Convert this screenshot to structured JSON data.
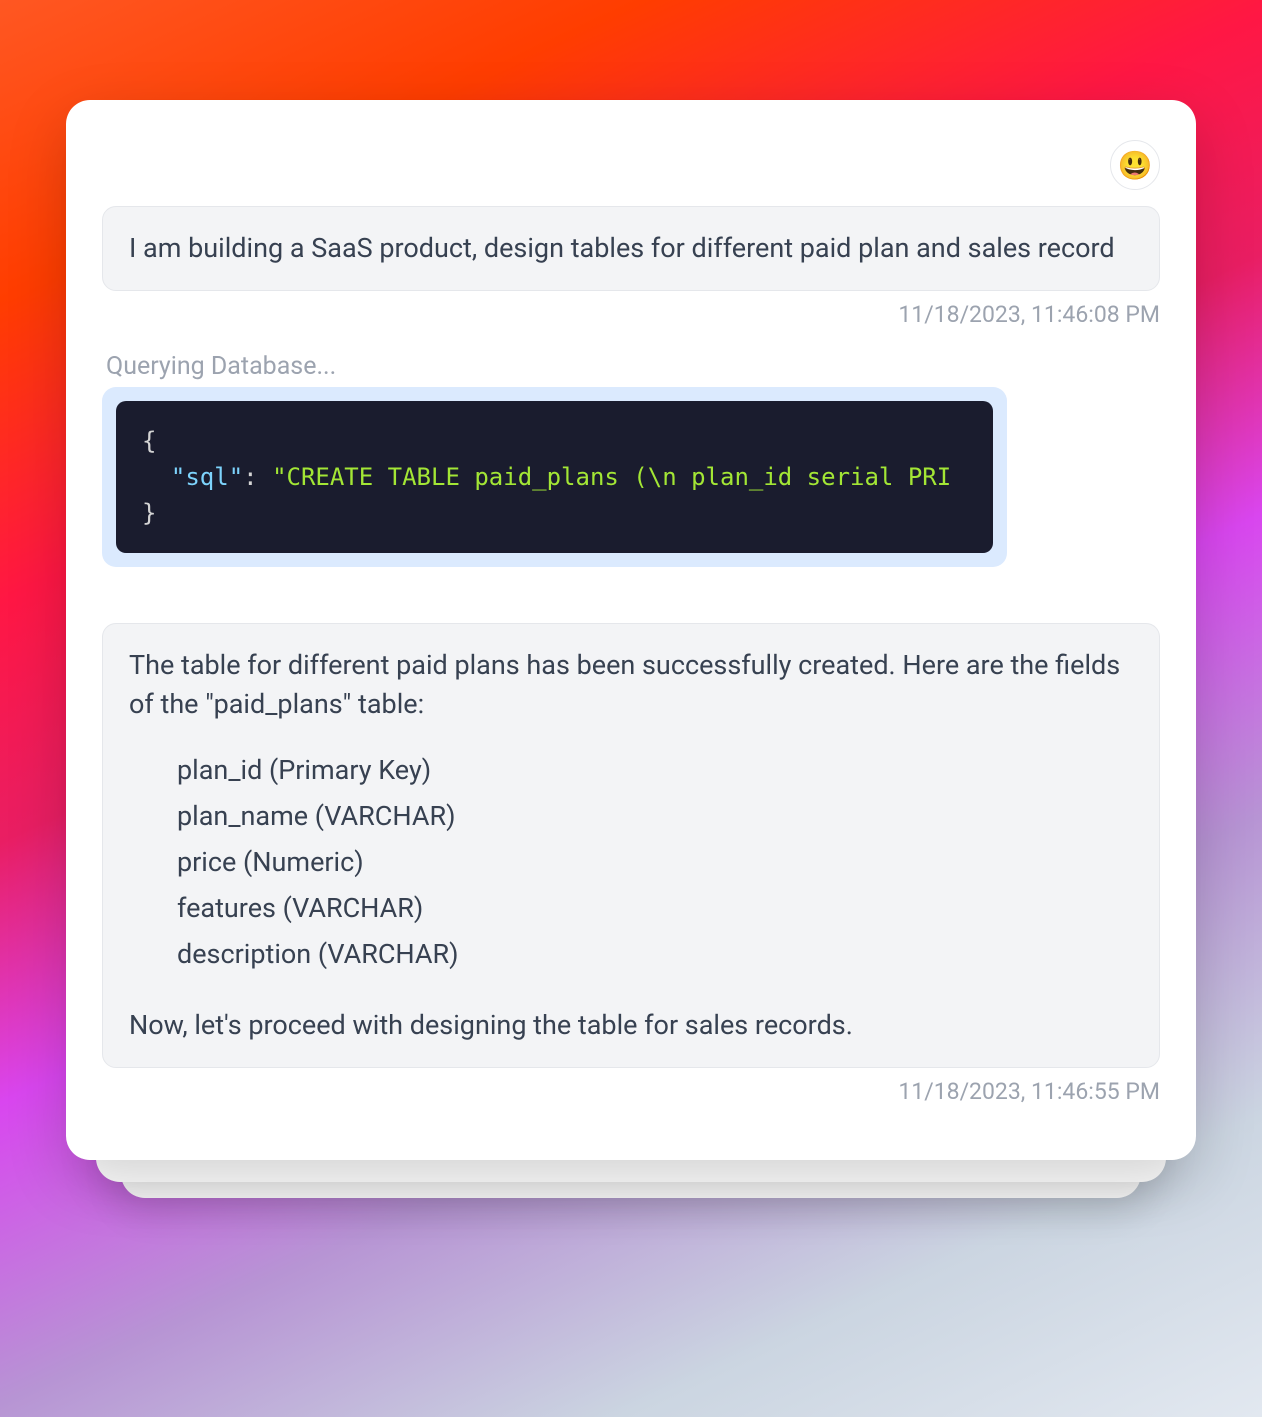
{
  "avatar_emoji": "😃",
  "user_message": {
    "text": "I am building a SaaS product, design tables for different paid plan and sales record",
    "timestamp": "11/18/2023, 11:46:08 PM"
  },
  "status": "Querying Database...",
  "code": {
    "open_brace": "{",
    "key": "\"sql\"",
    "colon": ": ",
    "value": "\"CREATE TABLE paid_plans (\\n  plan_id serial PRI",
    "close_brace": "}"
  },
  "assistant_message": {
    "intro": "The table for different paid plans has been successfully created. Here are the fields of the \"paid_plans\" table:",
    "fields": [
      "plan_id (Primary Key)",
      "plan_name (VARCHAR)",
      "price (Numeric)",
      "features (VARCHAR)",
      "description (VARCHAR)"
    ],
    "outro": "Now, let's proceed with designing the table for sales records.",
    "timestamp": "11/18/2023, 11:46:55 PM"
  }
}
